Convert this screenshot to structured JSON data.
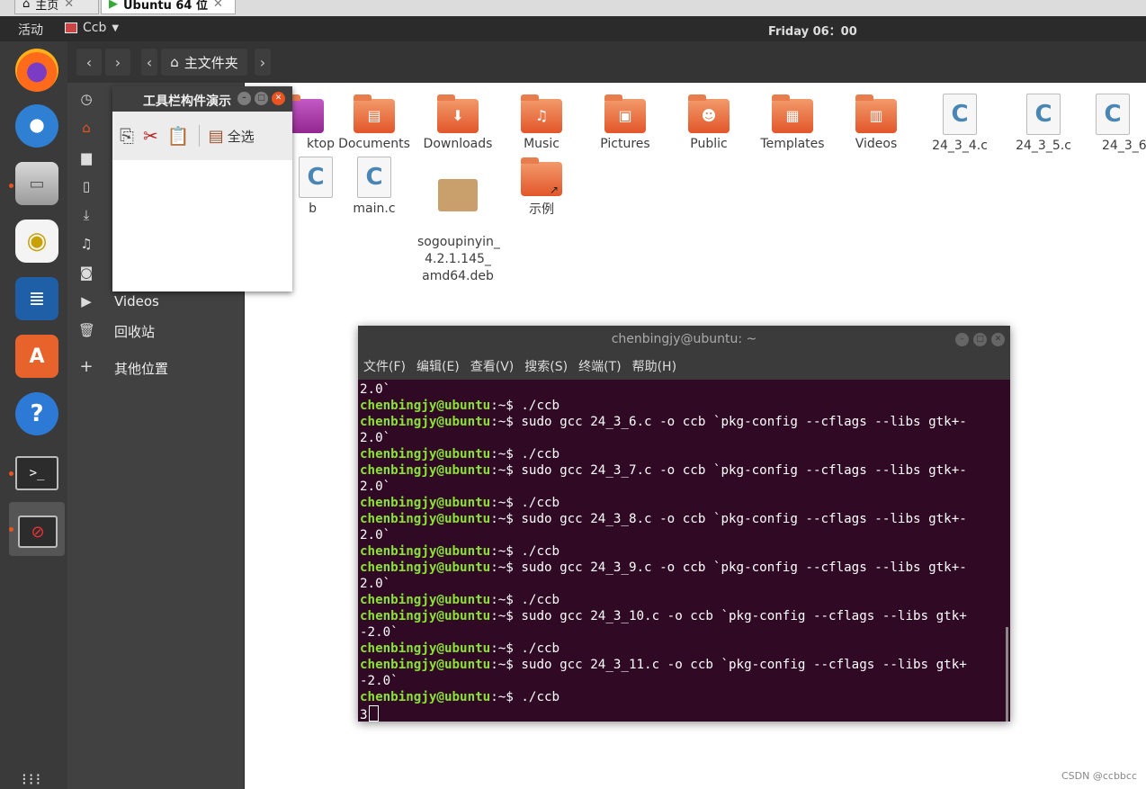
{
  "vm_tabs": [
    {
      "label": "主页"
    },
    {
      "label": "Ubuntu 64 位"
    }
  ],
  "topbar": {
    "activities": "活动",
    "app_name": "Ccb",
    "clock": "Friday 06：00"
  },
  "files": {
    "location": "主文件夹",
    "sidebar": [
      {
        "icon": "recent-icon",
        "label": ""
      },
      {
        "icon": "home-icon",
        "label": ""
      },
      {
        "icon": "folder-icon",
        "label": ""
      },
      {
        "icon": "document-icon",
        "label": ""
      },
      {
        "icon": "download-icon",
        "label": ""
      },
      {
        "icon": "music-icon",
        "label": ""
      },
      {
        "icon": "camera-icon",
        "label": ""
      },
      {
        "icon": "video-icon",
        "label": "Videos"
      },
      {
        "icon": "trash-icon",
        "label": "回收站"
      },
      {
        "icon": "plus-icon",
        "label": "其他位置"
      }
    ],
    "items": [
      {
        "name": "ktop",
        "type": "folder"
      },
      {
        "name": "Documents",
        "type": "folder",
        "icon": "document-icon"
      },
      {
        "name": "Downloads",
        "type": "folder",
        "icon": "download-icon"
      },
      {
        "name": "Music",
        "type": "folder",
        "icon": "music-icon"
      },
      {
        "name": "Pictures",
        "type": "folder",
        "icon": "picture-icon"
      },
      {
        "name": "Public",
        "type": "folder",
        "icon": "person-icon"
      },
      {
        "name": "Templates",
        "type": "folder",
        "icon": "template-icon"
      },
      {
        "name": "Videos",
        "type": "folder",
        "icon": "video-icon"
      },
      {
        "name": "24_3_4.c",
        "type": "cfile"
      },
      {
        "name": "24_3_5.c",
        "type": "cfile"
      },
      {
        "name": "24_3_6.",
        "type": "cfile"
      },
      {
        "name": "b",
        "type": "cfile"
      },
      {
        "name": "main.c",
        "type": "cfile"
      },
      {
        "name": "sogoupinyin_\n4.2.1.145_\namd64.deb",
        "type": "deb"
      },
      {
        "name": "示例",
        "type": "folder",
        "icon": "link-icon"
      }
    ]
  },
  "toolbar_window": {
    "title": "工具栏构件演示",
    "tools": [
      {
        "icon": "copy-icon"
      },
      {
        "icon": "cut-icon"
      },
      {
        "icon": "paste-icon"
      }
    ],
    "select_all": "全选"
  },
  "terminal": {
    "title": "chenbingjy@ubuntu: ~",
    "menu": [
      "文件(F)",
      "编辑(E)",
      "查看(V)",
      "搜索(S)",
      "终端(T)",
      "帮助(H)"
    ],
    "prompt": "chenbingjy@ubuntu",
    "lines": [
      {
        "p": "",
        "t": "2.0`"
      },
      {
        "p": "chenbingjy@ubuntu",
        "t": ":~$ ./ccb"
      },
      {
        "p": "chenbingjy@ubuntu",
        "t": ":~$ sudo gcc 24_3_6.c -o ccb `pkg-config --cflags --libs gtk+-"
      },
      {
        "p": "",
        "t": "2.0`"
      },
      {
        "p": "chenbingjy@ubuntu",
        "t": ":~$ ./ccb"
      },
      {
        "p": "chenbingjy@ubuntu",
        "t": ":~$ sudo gcc 24_3_7.c -o ccb `pkg-config --cflags --libs gtk+-"
      },
      {
        "p": "",
        "t": "2.0`"
      },
      {
        "p": "chenbingjy@ubuntu",
        "t": ":~$ ./ccb"
      },
      {
        "p": "chenbingjy@ubuntu",
        "t": ":~$ sudo gcc 24_3_8.c -o ccb `pkg-config --cflags --libs gtk+-"
      },
      {
        "p": "",
        "t": "2.0`"
      },
      {
        "p": "chenbingjy@ubuntu",
        "t": ":~$ ./ccb"
      },
      {
        "p": "chenbingjy@ubuntu",
        "t": ":~$ sudo gcc 24_3_9.c -o ccb `pkg-config --cflags --libs gtk+-"
      },
      {
        "p": "",
        "t": "2.0`"
      },
      {
        "p": "chenbingjy@ubuntu",
        "t": ":~$ ./ccb"
      },
      {
        "p": "chenbingjy@ubuntu",
        "t": ":~$ sudo gcc 24_3_10.c -o ccb `pkg-config --cflags --libs gtk+"
      },
      {
        "p": "",
        "t": "-2.0`"
      },
      {
        "p": "chenbingjy@ubuntu",
        "t": ":~$ ./ccb"
      },
      {
        "p": "chenbingjy@ubuntu",
        "t": ":~$ sudo gcc 24_3_11.c -o ccb `pkg-config --cflags --libs gtk+"
      },
      {
        "p": "",
        "t": "-2.0`"
      },
      {
        "p": "chenbingjy@ubuntu",
        "t": ":~$ ./ccb"
      },
      {
        "p": "",
        "t": "3",
        "cursor": true
      }
    ]
  },
  "watermark": "CSDN @ccbbcc"
}
